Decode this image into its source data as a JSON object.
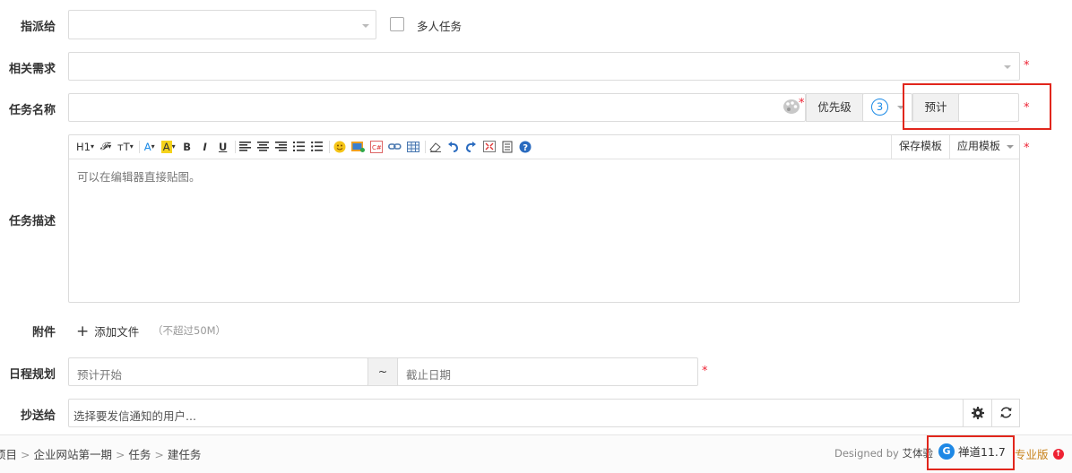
{
  "form": {
    "assign_to": {
      "label": "指派给",
      "multi_task_label": "多人任务"
    },
    "related_story": {
      "label": "相关需求"
    },
    "task_name": {
      "label": "任务名称",
      "priority_label": "优先级",
      "priority_value": "3",
      "estimate_label": "预计"
    },
    "description": {
      "label": "任务描述",
      "placeholder": "可以在编辑器直接贴图。",
      "save_template": "保存模板",
      "apply_template": "应用模板",
      "toolbar": {
        "heading": "H1",
        "font": "𝓕",
        "size": "тT",
        "font_color": "A",
        "bg_color": "A",
        "bold": "B",
        "italic": "I",
        "underline": "U"
      }
    },
    "attachment": {
      "label": "附件",
      "add_file": "添加文件",
      "hint": "（不超过50M）"
    },
    "schedule": {
      "label": "日程规划",
      "start_placeholder": "预计开始",
      "separator": "~",
      "deadline_placeholder": "截止日期"
    },
    "cc": {
      "label": "抄送给",
      "placeholder": "选择要发信通知的用户..."
    }
  },
  "footer": {
    "breadcrumb": [
      "项目",
      "企业网站第一期",
      "任务",
      "建任务"
    ],
    "designed_by": "Designed by",
    "designer": "艾体验",
    "product": "禅道11.7",
    "edition": "专业版"
  },
  "colors": {
    "required": "#ee2233",
    "highlight_box": "#e1261c",
    "priority_blue": "#1a8ae6",
    "brand_blue": "#1e88e5",
    "edition": "#c8821a"
  }
}
